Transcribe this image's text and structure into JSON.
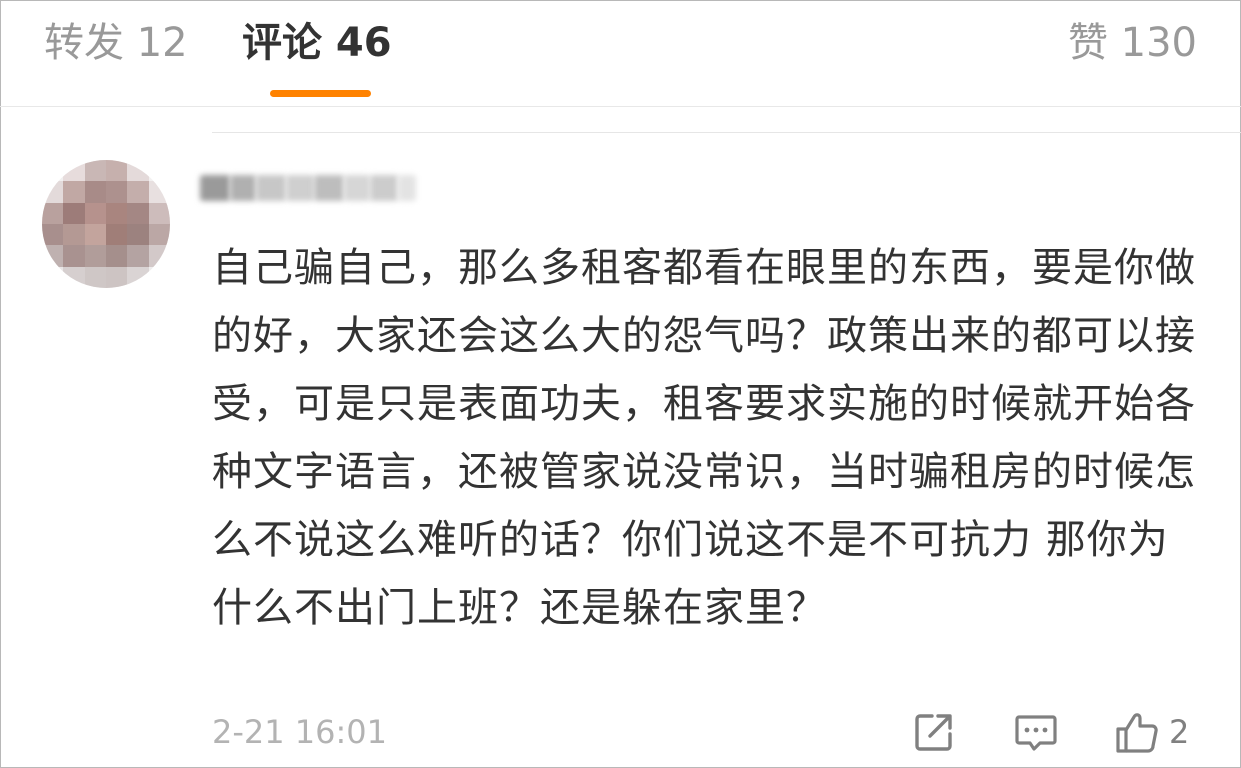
{
  "tabs": {
    "repost_label": "转发 12",
    "comment_label": "评论 46",
    "like_label": "赞 130"
  },
  "accent_color": "#ff8200",
  "comment": {
    "author_name": "",
    "text": "自己骗自己，那么多租客都看在眼里的东西，要是你做的好，大家还会这么大的怨气吗？政策出来的都可以接受，可是只是表面功夫，租客要求实施的时候就开始各种文字语言，还被管家说没常识，当时骗租房的时候怎么不说这么难听的话？你们说这不是不可抗力 那你为什么不出门上班？还是躲在家里？",
    "timestamp": "2-21 16:01",
    "like_count": "2"
  },
  "icons": {
    "share": "share-external-icon",
    "reply": "comment-bubble-icon",
    "like": "thumbs-up-icon"
  }
}
